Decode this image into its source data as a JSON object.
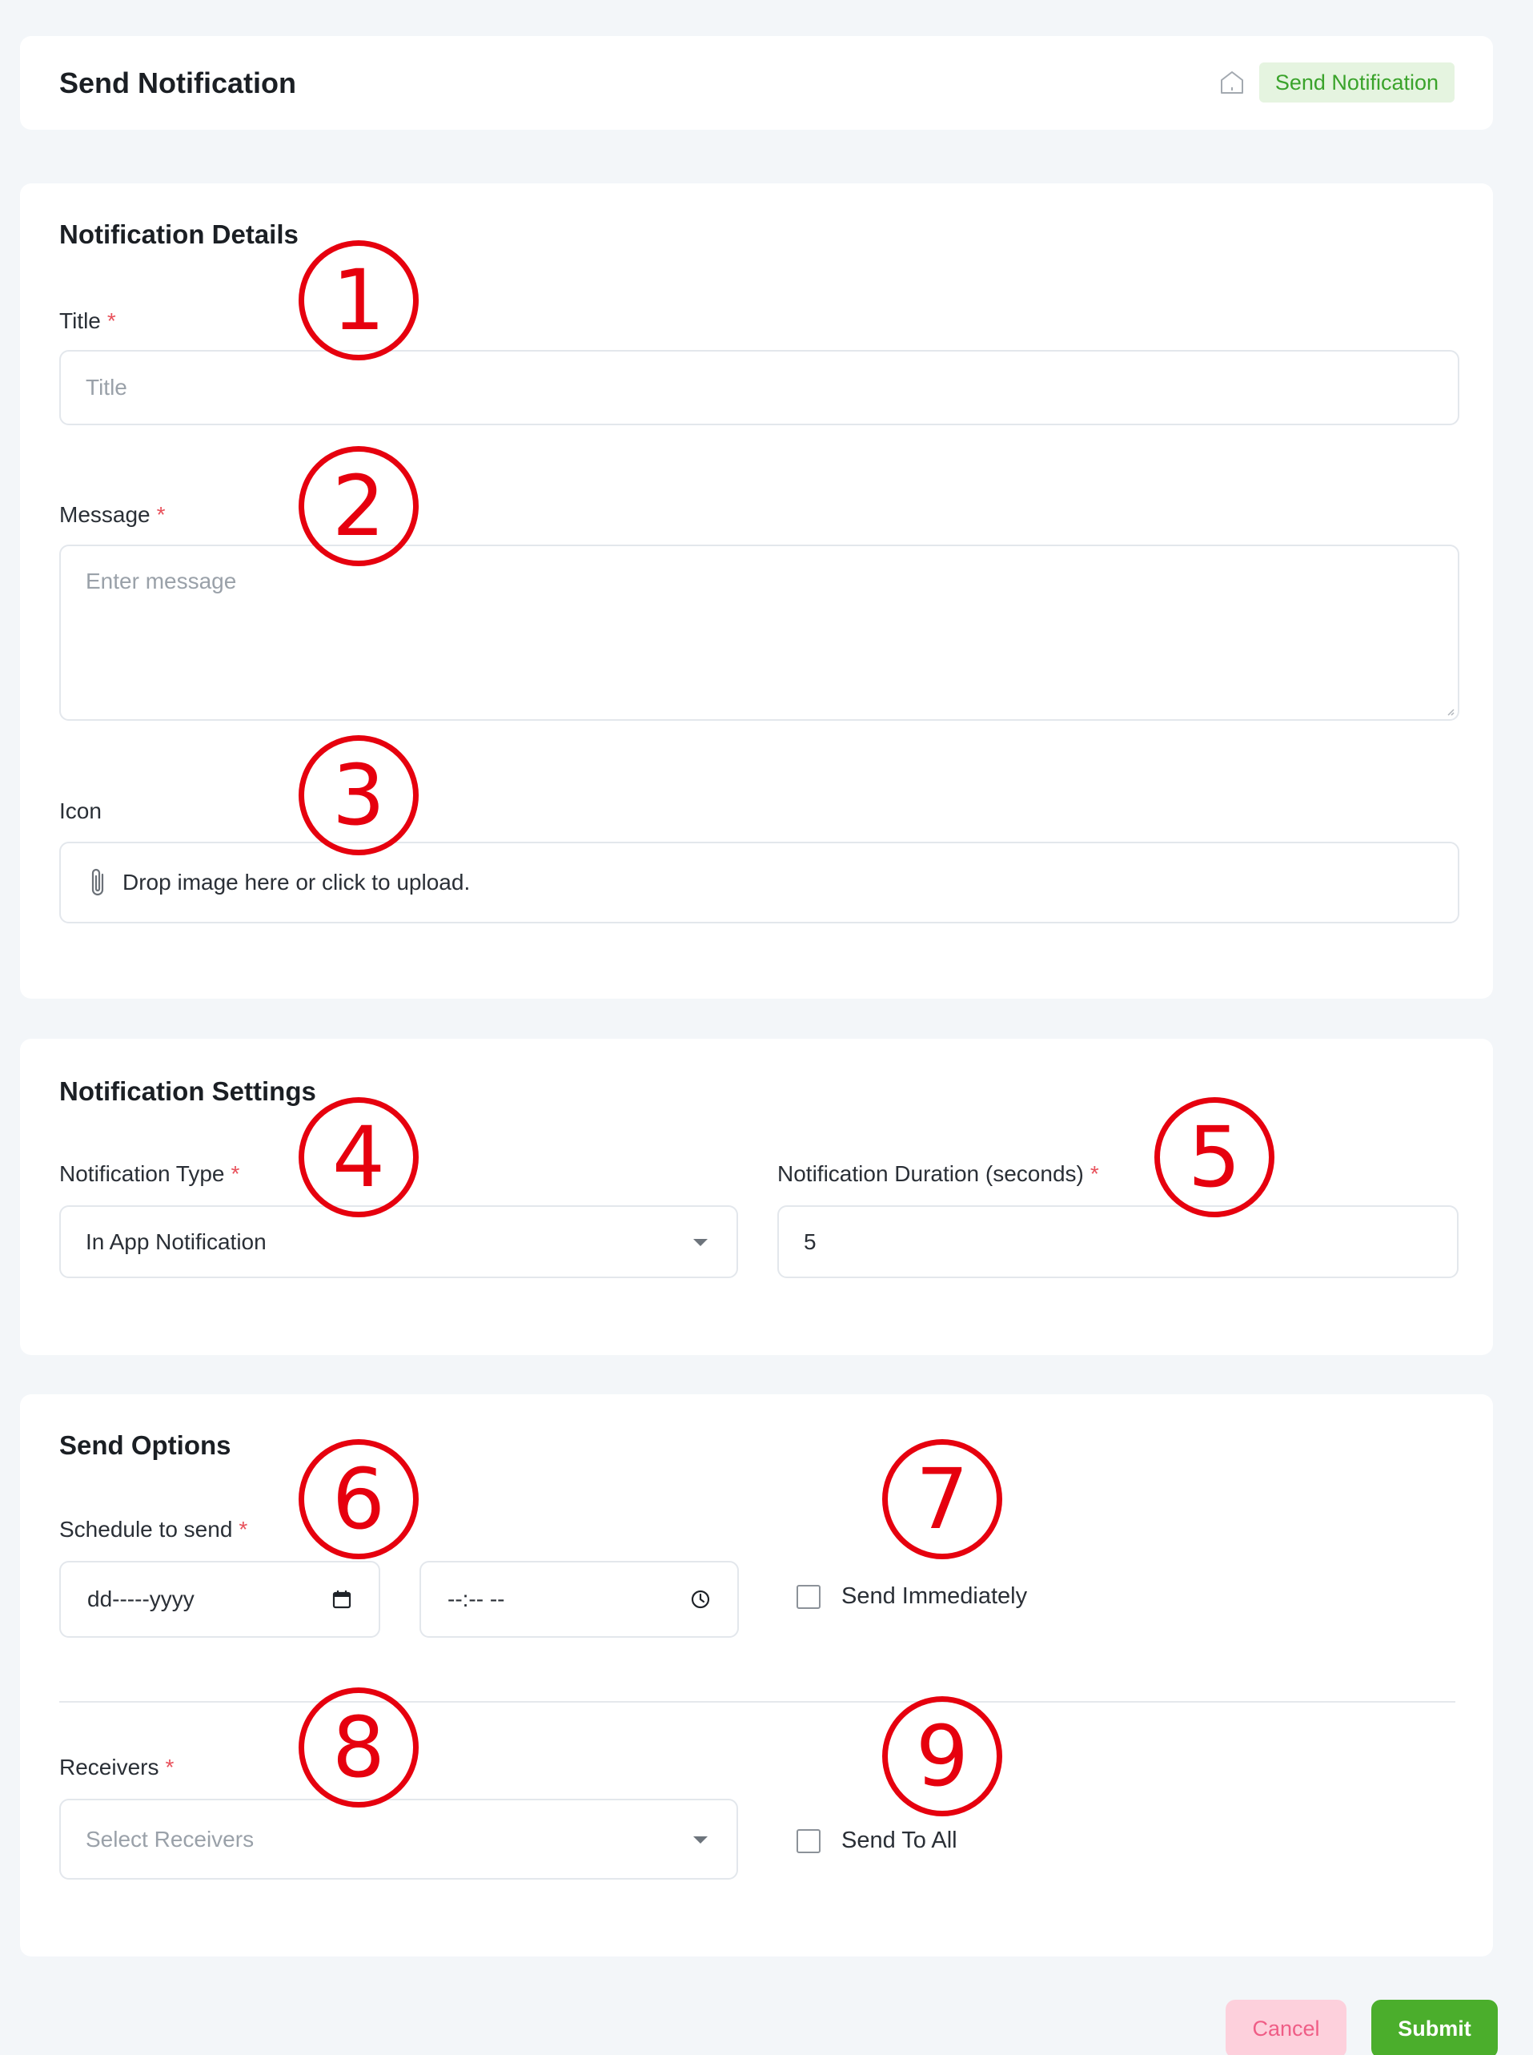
{
  "header": {
    "title": "Send Notification",
    "breadcrumb": "Send Notification"
  },
  "notification_details": {
    "section_title": "Notification Details",
    "title_label": "Title",
    "title_placeholder": "Title",
    "message_label": "Message",
    "message_placeholder": "Enter message",
    "icon_label": "Icon",
    "icon_upload_text": "Drop image here or click to upload."
  },
  "notification_settings": {
    "section_title": "Notification Settings",
    "type_label": "Notification Type",
    "type_value": "In App Notification",
    "duration_label": "Notification Duration (seconds)",
    "duration_value": "5"
  },
  "send_options": {
    "section_title": "Send Options",
    "schedule_label": "Schedule to send",
    "date_placeholder": "dd-----yyyy",
    "time_placeholder": "--:-- --",
    "send_immediately_label": "Send Immediately",
    "receivers_label": "Receivers",
    "receivers_placeholder": "Select Receivers",
    "send_to_all_label": "Send To All"
  },
  "required_mark": "*",
  "markers": [
    "1",
    "2",
    "3",
    "4",
    "5",
    "6",
    "7",
    "8",
    "9"
  ],
  "actions": {
    "cancel_label": "Cancel",
    "submit_label": "Submit"
  },
  "colors": {
    "accent_green": "#4bae2c",
    "badge_bg": "#e5f4e0",
    "cancel_bg": "#fdd0dc",
    "cancel_text": "#ef5d86",
    "required": "#e8515b",
    "annotation_red": "#e6000e"
  }
}
